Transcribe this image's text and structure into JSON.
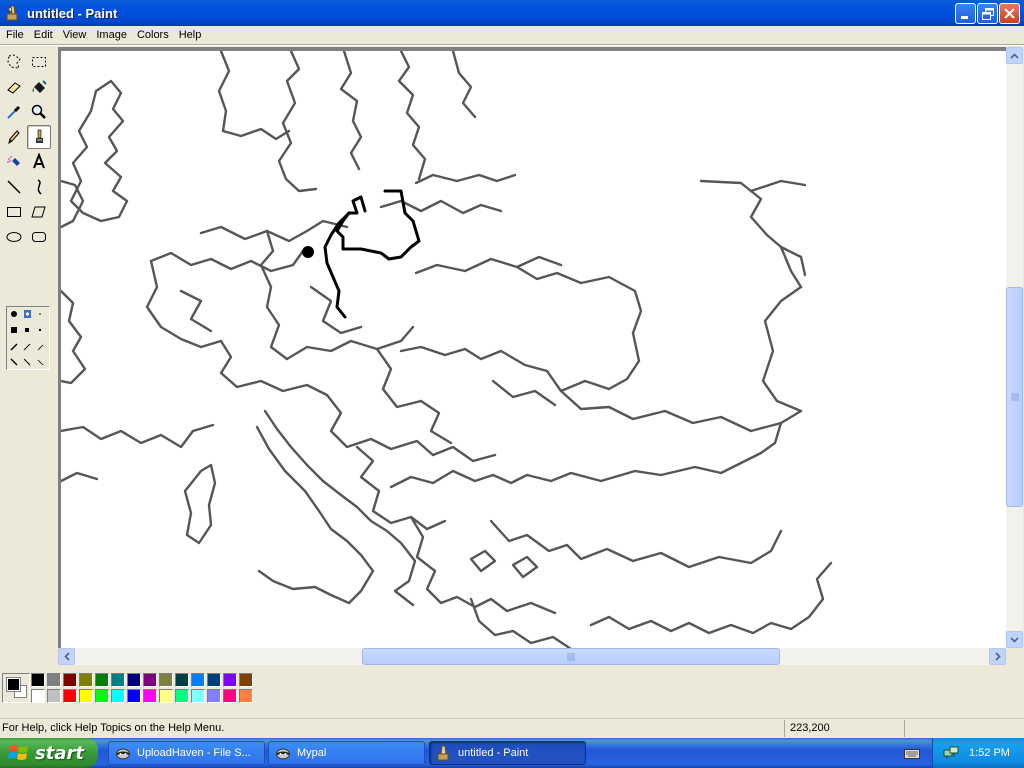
{
  "window": {
    "title": "untitled - Paint"
  },
  "menu": [
    "File",
    "Edit",
    "View",
    "Image",
    "Colors",
    "Help"
  ],
  "tools": [
    {
      "name": "free-form-select-tool",
      "icon": "free-form-select-icon"
    },
    {
      "name": "select-tool",
      "icon": "select-icon"
    },
    {
      "name": "eraser-tool",
      "icon": "eraser-icon"
    },
    {
      "name": "fill-tool",
      "icon": "fill-bucket-icon"
    },
    {
      "name": "pick-color-tool",
      "icon": "eyedropper-icon"
    },
    {
      "name": "magnifier-tool",
      "icon": "magnifier-icon"
    },
    {
      "name": "pencil-tool",
      "icon": "pencil-icon"
    },
    {
      "name": "brush-tool",
      "icon": "brush-icon",
      "selected": true
    },
    {
      "name": "airbrush-tool",
      "icon": "airbrush-icon"
    },
    {
      "name": "text-tool",
      "icon": "text-icon"
    },
    {
      "name": "line-tool",
      "icon": "line-icon"
    },
    {
      "name": "curve-tool",
      "icon": "curve-icon"
    },
    {
      "name": "rectangle-tool",
      "icon": "rectangle-icon"
    },
    {
      "name": "polygon-tool",
      "icon": "polygon-icon"
    },
    {
      "name": "ellipse-tool",
      "icon": "ellipse-icon"
    },
    {
      "name": "rounded-rectangle-tool",
      "icon": "rounded-rectangle-icon"
    }
  ],
  "palette": {
    "foreground": "#000000",
    "background": "#ffffff",
    "top_row": [
      "#000000",
      "#808080",
      "#800000",
      "#808000",
      "#008000",
      "#008080",
      "#000080",
      "#800080",
      "#808040",
      "#004040",
      "#0080ff",
      "#004080",
      "#8000ff",
      "#804000"
    ],
    "bottom_row": [
      "#ffffff",
      "#c0c0c0",
      "#ff0000",
      "#ffff00",
      "#00ff00",
      "#00ffff",
      "#0000ff",
      "#ff00ff",
      "#ffff80",
      "#00ff80",
      "#80ffff",
      "#8080ff",
      "#ff0080",
      "#ff8040"
    ]
  },
  "statusbar": {
    "help_text": "For Help, click Help Topics on the Help Menu.",
    "coordinates": "223,200"
  },
  "taskbar": {
    "start_label": "start",
    "tasks": [
      {
        "label": "UploadHaven - File S...",
        "icon": "raccoon-icon",
        "active": false
      },
      {
        "label": "Mypal",
        "icon": "raccoon-icon",
        "active": false
      },
      {
        "label": "untitled - Paint",
        "icon": "paint-icon",
        "active": true
      }
    ],
    "clock": "1:52 PM"
  }
}
